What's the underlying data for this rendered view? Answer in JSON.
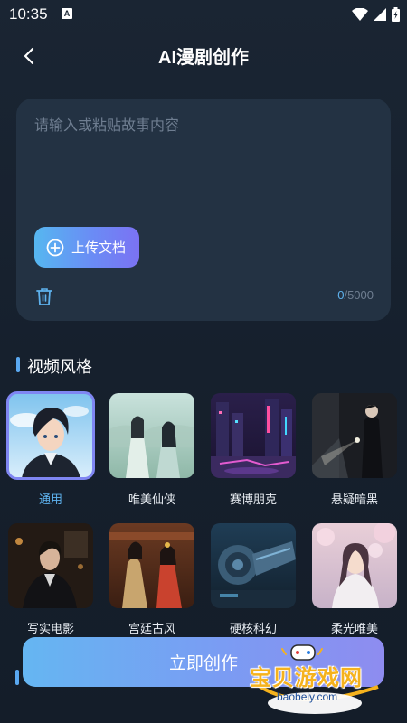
{
  "status_bar": {
    "time": "10:35",
    "notification_icon": "A"
  },
  "header": {
    "title": "AI漫剧创作",
    "back_icon": "chevron-left-icon"
  },
  "story_input": {
    "placeholder": "请输入或粘贴故事内容",
    "value": "",
    "upload_label": "上传文档",
    "char_current": "0",
    "char_max": "/5000"
  },
  "video_style": {
    "title": "视频风格",
    "selected_index": 0,
    "items": [
      {
        "label": "通用"
      },
      {
        "label": "唯美仙侠"
      },
      {
        "label": "赛博朋克"
      },
      {
        "label": "悬疑暗黑"
      },
      {
        "label": "写实电影"
      },
      {
        "label": "宫廷古风"
      },
      {
        "label": "硬核科幻"
      },
      {
        "label": "柔光唯美"
      }
    ]
  },
  "footer": {
    "create_label": "立即创作"
  },
  "watermark": {
    "text": "宝贝游戏网",
    "site": "baobeiy.com"
  },
  "colors": {
    "background": "#16202d",
    "card": "#233243",
    "accent": "#5eb2ee",
    "selected_border": "#7f86f2"
  }
}
